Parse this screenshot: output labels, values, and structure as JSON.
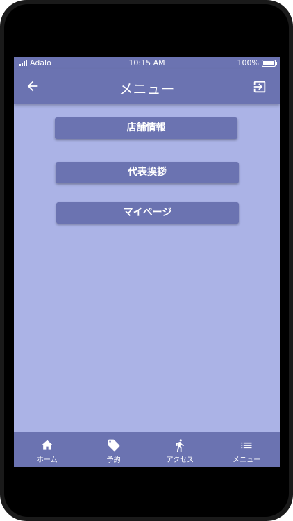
{
  "status_bar": {
    "carrier": "Adalo",
    "time": "10:15 AM",
    "battery": "100%"
  },
  "header": {
    "title": "メニュー",
    "back_icon": "arrow-left-icon",
    "exit_icon": "exit-icon"
  },
  "menu_buttons": [
    {
      "label": "店舗情報"
    },
    {
      "label": "代表挨拶"
    },
    {
      "label": "マイページ"
    }
  ],
  "tabs": [
    {
      "label": "ホーム",
      "icon": "home-icon"
    },
    {
      "label": "予約",
      "icon": "tag-icon"
    },
    {
      "label": "アクセス",
      "icon": "walk-icon"
    },
    {
      "label": "メニュー",
      "icon": "list-icon"
    }
  ],
  "colors": {
    "primary": "#6b73b1",
    "background": "#abb3e6",
    "text": "#ffffff"
  }
}
